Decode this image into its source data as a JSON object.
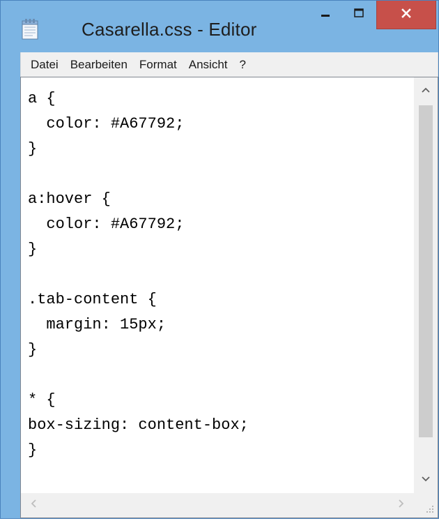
{
  "window": {
    "title": "Casarella.css - Editor",
    "icon": "notepad-icon",
    "controls": {
      "minimize": "minimize-icon",
      "maximize": "maximize-icon",
      "close": "close-icon"
    },
    "colors": {
      "frame": "#7bb4e3",
      "close": "#c7504a"
    }
  },
  "menu": {
    "items": [
      {
        "label": "Datei"
      },
      {
        "label": "Bearbeiten"
      },
      {
        "label": "Format"
      },
      {
        "label": "Ansicht"
      },
      {
        "label": "?"
      }
    ]
  },
  "editor": {
    "lines": [
      "a {",
      "  color: #A67792;",
      "}",
      "",
      "a:hover {",
      "  color: #A67792;",
      "}",
      "",
      ".tab-content {",
      "  margin: 15px;",
      "}",
      "",
      "* {",
      "box-sizing: content-box;",
      "}"
    ]
  }
}
